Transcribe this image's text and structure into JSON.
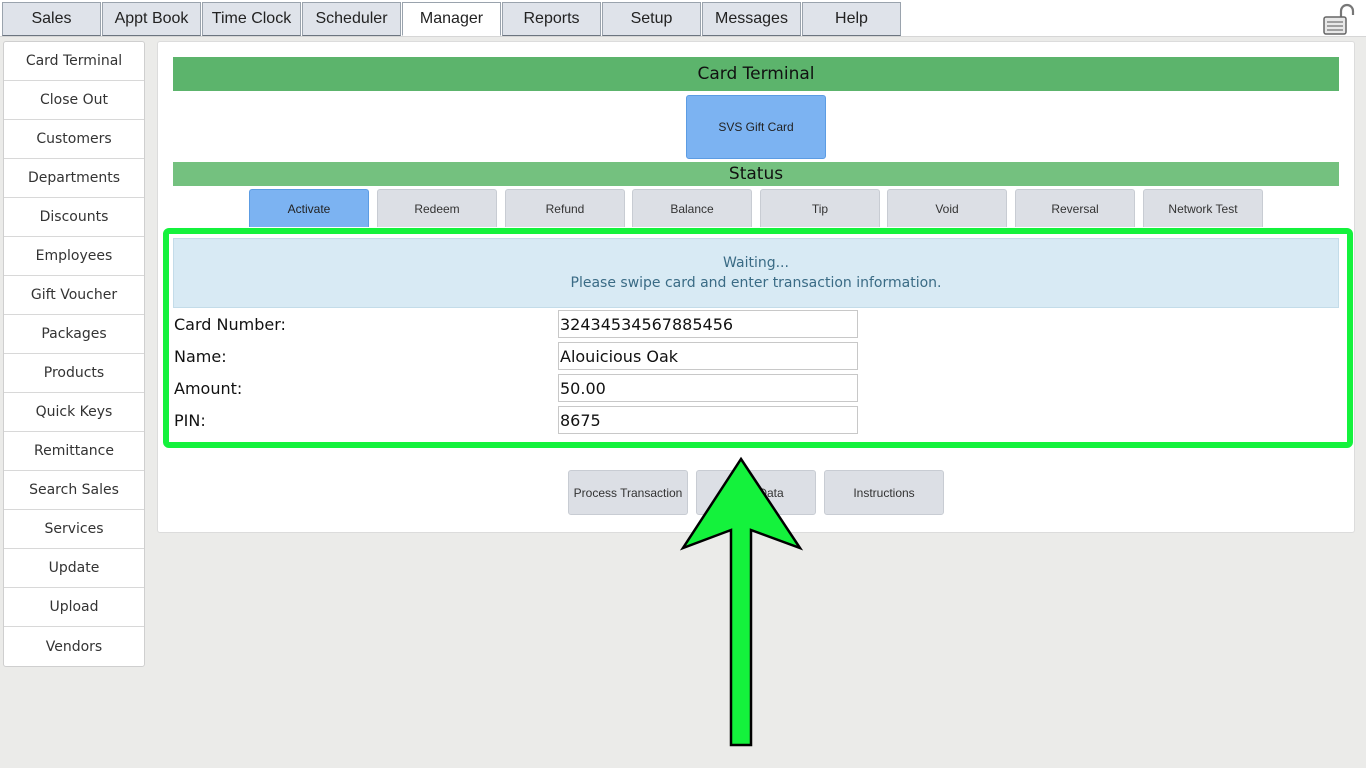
{
  "top_tabs": [
    "Sales",
    "Appt Book",
    "Time Clock",
    "Scheduler",
    "Manager",
    "Reports",
    "Setup",
    "Messages",
    "Help"
  ],
  "active_tab": "Manager",
  "sidebar": {
    "items": [
      "Card Terminal",
      "Close Out",
      "Customers",
      "Departments",
      "Discounts",
      "Employees",
      "Gift Voucher",
      "Packages",
      "Products",
      "Quick Keys",
      "Remittance",
      "Search Sales",
      "Services",
      "Update",
      "Upload",
      "Vendors"
    ]
  },
  "main": {
    "title": "Card Terminal",
    "card_type_button": "SVS Gift Card",
    "status_label": "Status",
    "actions": [
      "Activate",
      "Redeem",
      "Refund",
      "Balance",
      "Tip",
      "Void",
      "Reversal",
      "Network Test"
    ],
    "selected_action": "Activate",
    "message": {
      "line1": "Waiting...",
      "line2": "Please swipe card and enter transaction information."
    },
    "fields": {
      "card_number": {
        "label": "Card Number:",
        "value": "32434534567885456"
      },
      "name": {
        "label": "Name:",
        "value": "Alouicious Oak"
      },
      "amount": {
        "label": "Amount:",
        "value": "50.00"
      },
      "pin": {
        "label": "PIN:",
        "value": "8675"
      }
    },
    "footer_buttons": {
      "process": "Process Transaction",
      "data": "Data",
      "instructions": "Instructions"
    }
  },
  "annotation": {
    "highlight_color": "#14f23c",
    "arrow_color": "#14f23c"
  },
  "colors": {
    "header_green": "#5cb46c",
    "status_green": "#74c17f",
    "selected_blue": "#7cb3f2",
    "message_bg": "#d8eaf4"
  },
  "icons": {
    "lock": "lock-icon"
  }
}
